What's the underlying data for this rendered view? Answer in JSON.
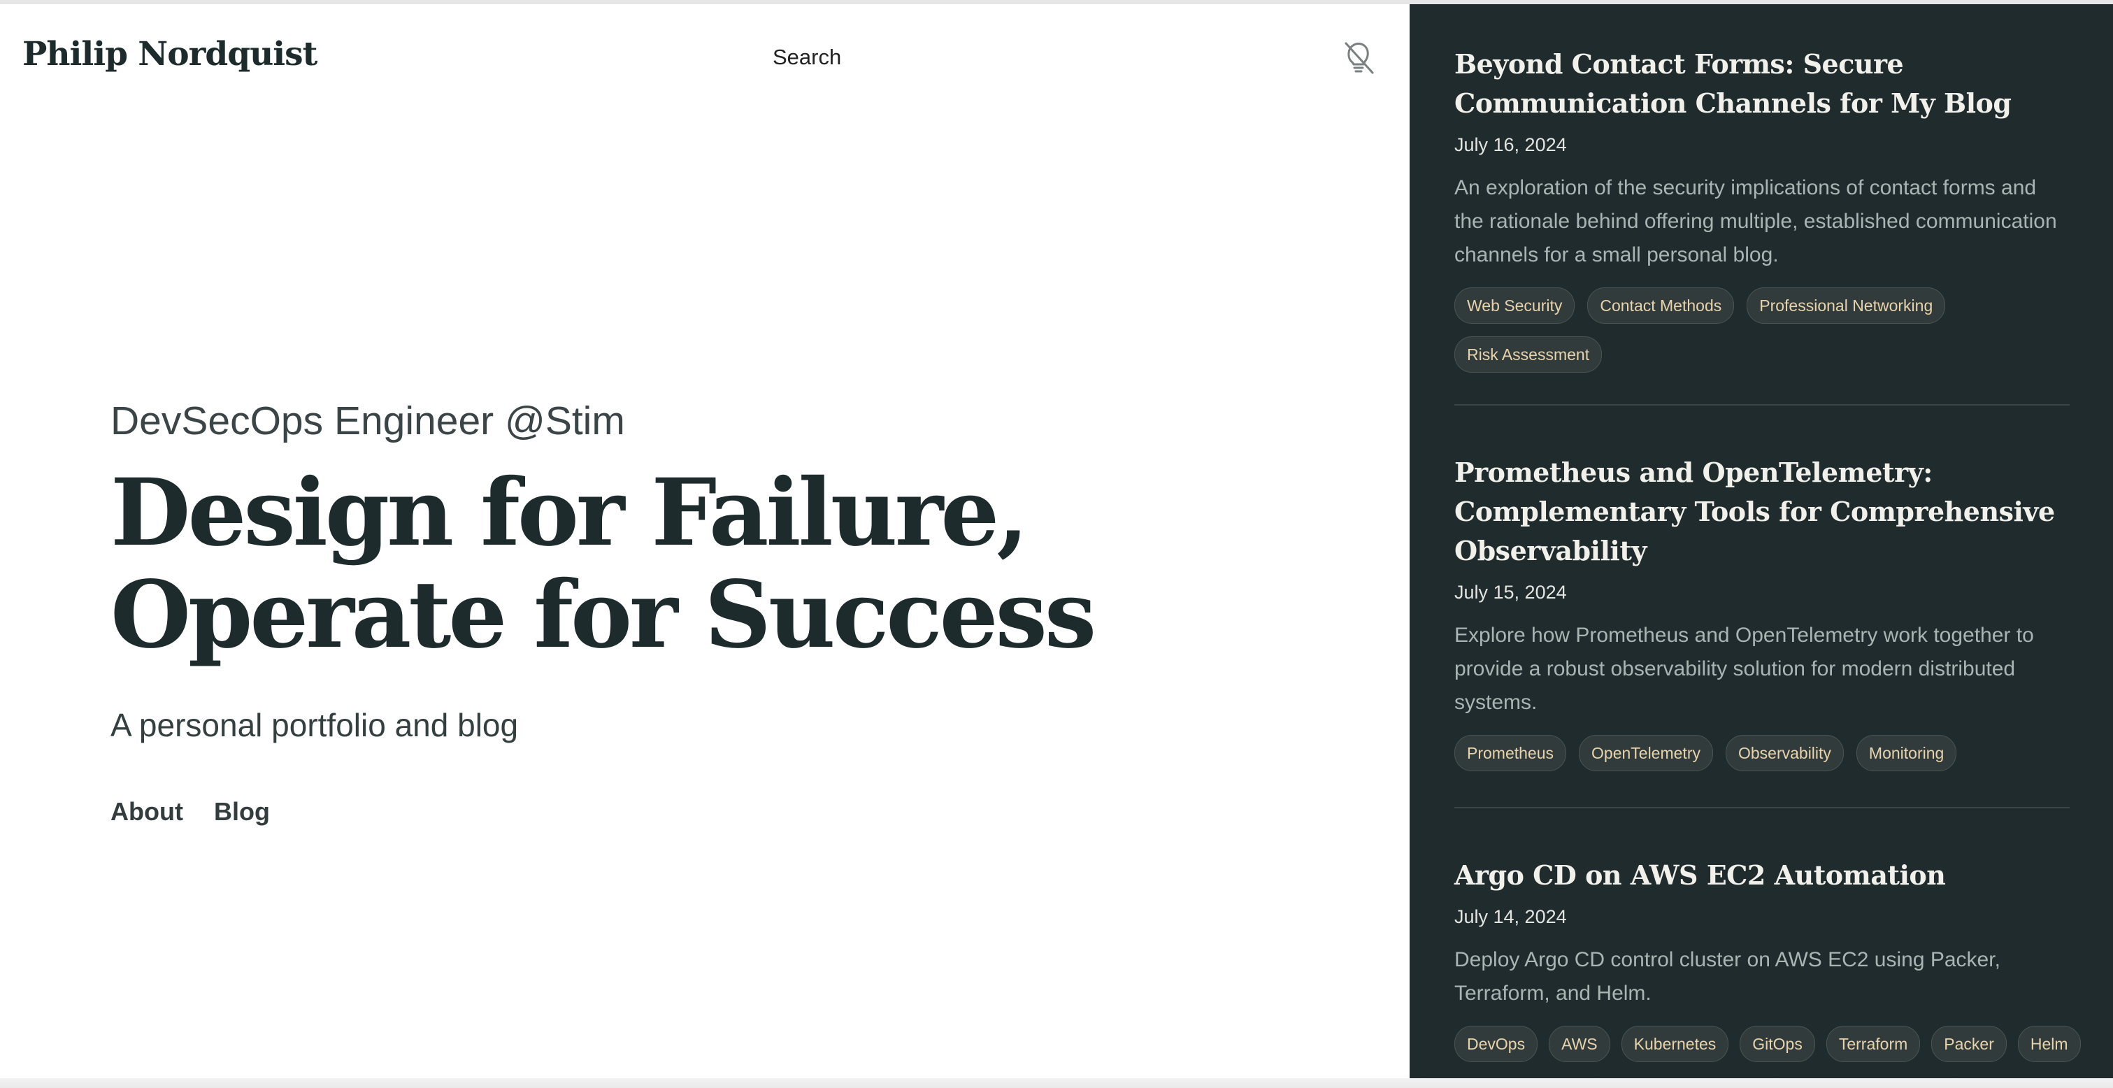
{
  "header": {
    "brand": "Philip Nordquist",
    "search_label": "Search",
    "theme_icon": "lightbulb-off-icon"
  },
  "hero": {
    "subtitle": "DevSecOps Engineer @Stim",
    "title_line1": "Design for Failure,",
    "title_line2": "Operate for Success",
    "tagline": "A personal portfolio and blog",
    "nav": {
      "about": "About",
      "blog": "Blog"
    }
  },
  "posts": [
    {
      "title": "Beyond Contact Forms: Secure Communication Channels for My Blog",
      "date": "July 16, 2024",
      "description": "An exploration of the security implications of contact forms and the rationale behind offering multiple, established communication channels for a small personal blog.",
      "tags": [
        "Web Security",
        "Contact Methods",
        "Professional Networking",
        "Risk Assessment"
      ]
    },
    {
      "title": "Prometheus and OpenTelemetry: Complementary Tools for Comprehensive Observability",
      "date": "July 15, 2024",
      "description": "Explore how Prometheus and OpenTelemetry work together to provide a robust observability solution for modern distributed systems.",
      "tags": [
        "Prometheus",
        "OpenTelemetry",
        "Observability",
        "Monitoring"
      ]
    },
    {
      "title": "Argo CD on AWS EC2 Automation",
      "date": "July 14, 2024",
      "description": "Deploy Argo CD control cluster on AWS EC2 using Packer, Terraform, and Helm.",
      "tags": [
        "DevOps",
        "AWS",
        "Kubernetes",
        "GitOps",
        "Terraform",
        "Packer",
        "Helm"
      ]
    }
  ],
  "colors": {
    "ink": "#1e2b2d",
    "sidebar_bg": "#1f2b2c",
    "tag_text": "#e7d3ac"
  }
}
